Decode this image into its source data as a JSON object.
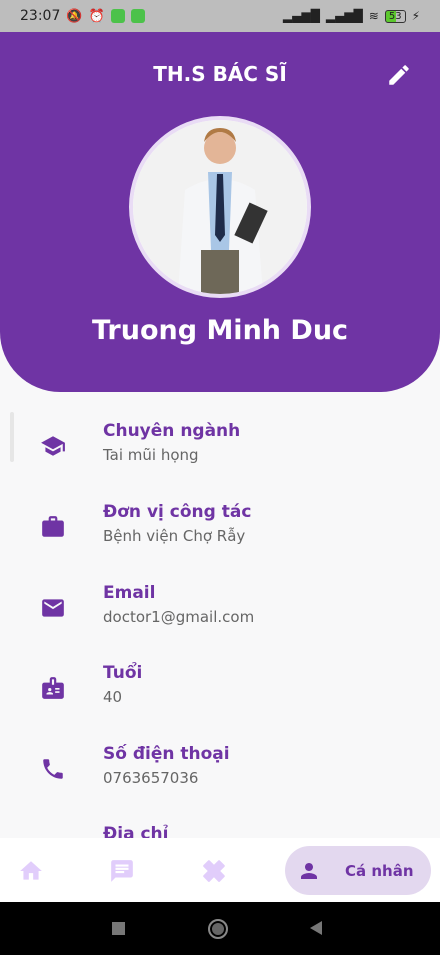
{
  "status_bar": {
    "time": "23:07",
    "battery": "53"
  },
  "header": {
    "title": "TH.S BÁC SĨ",
    "name": "Truong Minh Duc"
  },
  "colors": {
    "primary": "#6f34a4",
    "pill": "#e3d8ef",
    "nav_inactive": "#e1cdfb"
  },
  "items": [
    {
      "icon": "graduation-cap-icon",
      "label": "Chuyên ngành",
      "value": "Tai mũi họng"
    },
    {
      "icon": "briefcase-icon",
      "label": "Đơn vị công tác",
      "value": "Bệnh viện Chợ Rẫy"
    },
    {
      "icon": "email-icon",
      "label": "Email",
      "value": "doctor1@gmail.com"
    },
    {
      "icon": "id-badge-icon",
      "label": "Tuổi",
      "value": "40"
    },
    {
      "icon": "phone-icon",
      "label": "Số điện thoại",
      "value": "0763657036"
    },
    {
      "icon": "location-icon",
      "label": "Địa chỉ",
      "value": ""
    }
  ],
  "bottom_nav": {
    "items": [
      "home-icon",
      "chat-icon",
      "bandage-icon"
    ],
    "active_label": "Cá nhân"
  }
}
